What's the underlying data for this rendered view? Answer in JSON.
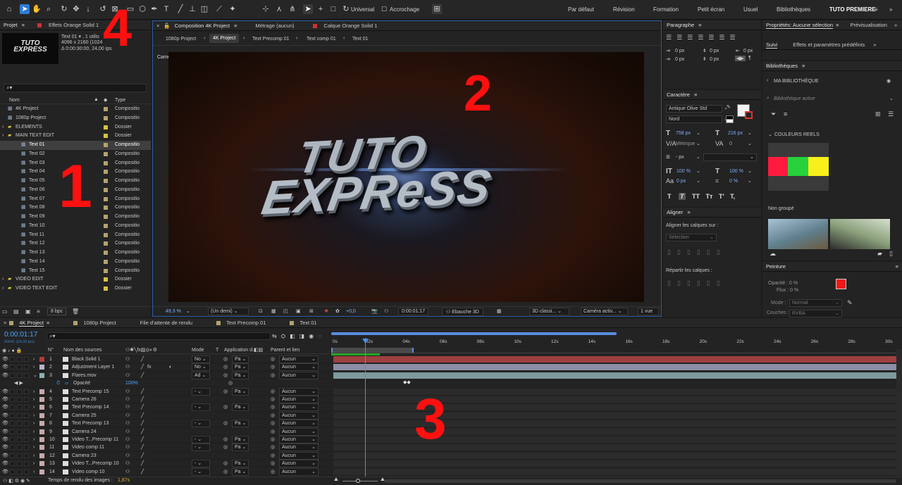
{
  "toolbar": {
    "universal": "Universal",
    "accrochage": "Accrochage"
  },
  "workspaces": [
    "Par défaut",
    "Révision",
    "Formation",
    "Petit écran",
    "Usuel",
    "Bibliothèques",
    "TUTO PREMIERE"
  ],
  "project": {
    "tab": "Projet",
    "effects_tab": "Effets  Orange Solid 1",
    "thumb_text1": "TUTO",
    "thumb_text2": "EXPRESS",
    "info_line1": "Text 01 ▾ , 1 utilis",
    "info_line2": "4096 x 2160  (1024",
    "info_line3": "Δ 0:00:30:00, 24,00 ips",
    "col_name": "Nom",
    "col_type": "Type",
    "bpc": "8 bpc",
    "items": [
      {
        "name": "4K Project",
        "type": "Compositio",
        "color": "#b3a36c",
        "folder": false,
        "indent": 0
      },
      {
        "name": "1080p Project",
        "type": "Compositio",
        "color": "#b3a36c",
        "folder": false,
        "indent": 0
      },
      {
        "name": "ELEMENTS",
        "type": "Dossier",
        "color": "#d6c43f",
        "folder": true,
        "indent": 0
      },
      {
        "name": "MAIN TEXT EDIT",
        "type": "Dossier",
        "color": "#d6c43f",
        "folder": true,
        "indent": 0
      },
      {
        "name": "Text 01",
        "type": "Compositio",
        "color": "#b3a36c",
        "folder": false,
        "indent": 1,
        "selected": true
      },
      {
        "name": "Text 02",
        "type": "Compositio",
        "color": "#b3a36c",
        "folder": false,
        "indent": 1
      },
      {
        "name": "Text 03",
        "type": "Compositio",
        "color": "#b3a36c",
        "folder": false,
        "indent": 1
      },
      {
        "name": "Text 04",
        "type": "Compositio",
        "color": "#b3a36c",
        "folder": false,
        "indent": 1
      },
      {
        "name": "Text 05",
        "type": "Compositio",
        "color": "#b3a36c",
        "folder": false,
        "indent": 1
      },
      {
        "name": "Text 06",
        "type": "Compositio",
        "color": "#b3a36c",
        "folder": false,
        "indent": 1
      },
      {
        "name": "Text 07",
        "type": "Compositio",
        "color": "#b3a36c",
        "folder": false,
        "indent": 1
      },
      {
        "name": "Text 08",
        "type": "Compositio",
        "color": "#b3a36c",
        "folder": false,
        "indent": 1
      },
      {
        "name": "Text 09",
        "type": "Compositio",
        "color": "#b3a36c",
        "folder": false,
        "indent": 1
      },
      {
        "name": "Text 10",
        "type": "Compositio",
        "color": "#b3a36c",
        "folder": false,
        "indent": 1
      },
      {
        "name": "Text 11",
        "type": "Compositio",
        "color": "#b3a36c",
        "folder": false,
        "indent": 1
      },
      {
        "name": "Text 12",
        "type": "Compositio",
        "color": "#b3a36c",
        "folder": false,
        "indent": 1
      },
      {
        "name": "Text 13",
        "type": "Compositio",
        "color": "#b3a36c",
        "folder": false,
        "indent": 1
      },
      {
        "name": "Text 14",
        "type": "Compositio",
        "color": "#b3a36c",
        "folder": false,
        "indent": 1
      },
      {
        "name": "Text 15",
        "type": "Compositio",
        "color": "#b3a36c",
        "folder": false,
        "indent": 1
      },
      {
        "name": "VIDEO EDIT",
        "type": "Dossier",
        "color": "#d6c43f",
        "folder": true,
        "indent": 0
      },
      {
        "name": "VIDEO TEXT EDIT",
        "type": "Dossier",
        "color": "#d6c43f",
        "folder": true,
        "indent": 0
      }
    ]
  },
  "comp": {
    "tab": "Composition  4K Project",
    "metrage_tab": "Métrage  (aucun)",
    "calque_tab": "Calque  Orange Solid 1",
    "breadcrumbs": [
      "1080p Project",
      "4K Project",
      "Text Precomp 01",
      "Text comp 01",
      "Text 01"
    ],
    "active_camera": "Caméra active (Camera 1)",
    "title1": "TUTO",
    "title2": "EXPReSS",
    "zoom": "49,3 %",
    "resolution": "(Un demi)",
    "exposure": "+0,0",
    "timecode": "0:00:01:17",
    "draft": "Ebauche 3D",
    "renderer": "3D classi...",
    "camera": "Caméra activ...",
    "views": "1 vue"
  },
  "paragraph": {
    "title": "Paragraphe",
    "values": [
      "0 px",
      "0 px",
      "0 px",
      "0 px",
      "0 px"
    ]
  },
  "character": {
    "title": "Caractère",
    "font": "Antique Olive Std",
    "style": "Nord",
    "size": "758 px",
    "leading": "216 px",
    "kerning": "Métrique",
    "tracking": "0",
    "stroke": "- px",
    "vscale": "100 %",
    "hscale": "100 %",
    "baseline": "0 px",
    "tsume": "0 %",
    "styles": [
      "T",
      "T",
      "TT",
      "Tт",
      "T'",
      "T,"
    ]
  },
  "align": {
    "title": "Aligner",
    "align_to_label": "Aligner les calques sur :",
    "align_to_value": "Sélection",
    "distribute_label": "Répartir les calques :"
  },
  "properties": {
    "title": "Propriétés: Aucune sélection",
    "preview": "Prévisualisation",
    "suivi": "Suivi",
    "effects": "Effets et paramètres prédéfinis"
  },
  "libraries": {
    "title": "Bibliothèques",
    "my_library": "MA BIBLIOTHÈQUE",
    "active": "Bibliothèque active",
    "colors_title": "COULEURS REELS",
    "ungrouped": "Non groupé",
    "colors": [
      "#ff1a40",
      "#27d13d",
      "#f7f01a"
    ]
  },
  "paint": {
    "title": "Peinture",
    "opacity": "Opacité : 0 %",
    "flow": "Flux : 0 %",
    "mode_label": "Mode :",
    "mode_value": "Normal",
    "channels_label": "Couches :",
    "channels_value": "RVBA"
  },
  "timeline": {
    "tabs": [
      "4K Project",
      "1080p Project",
      "File d'attente de rendu",
      "Text Precomp 01",
      "Text 01"
    ],
    "timecode": "0:00:01:17",
    "fps": "00041 (24,00 ips)",
    "col_source": "Nom des sources",
    "col_mode": "Mode",
    "col_t": "T",
    "col_app": "Application d...",
    "col_parent": "Parent et lien",
    "ruler": [
      "0s",
      "02s",
      "04s",
      "06s",
      "08s",
      "10s",
      "12s",
      "14s",
      "16s",
      "18s",
      "20s",
      "22s",
      "24s",
      "26s",
      "28s",
      "30s"
    ],
    "opacity_label": "Opacité",
    "opacity_value": "100%",
    "render_time_label": "Temps de rendu des images :",
    "render_time_value": "1,87s",
    "layers": [
      {
        "num": "1",
        "name": "Black Solid 1",
        "color": "#b23b3b",
        "mode": "No",
        "mode_dd": true,
        "parent": "Aucun",
        "bar": "#9e4040",
        "fx": false
      },
      {
        "num": "2",
        "name": "Adjustment Layer 1",
        "color": "#b6b6c8",
        "mode": "No",
        "mode_dd": true,
        "parent": "Aucun",
        "bar": "#8d8da6",
        "fx": true
      },
      {
        "num": "3",
        "name": "Flares.mov",
        "color": "#8fb1b4",
        "mode": "Ad",
        "mode_dd": true,
        "parent": "Aucun",
        "bar": "#7e9a9c",
        "fx": false
      },
      {
        "num": "",
        "name": "Opacité",
        "color": "",
        "mode": "",
        "mode_dd": false,
        "parent": "",
        "bar": "",
        "fx": false,
        "sub": true
      },
      {
        "num": "4",
        "name": "Text Precomp 15",
        "color": "#c9a9a9",
        "mode": "-",
        "mode_dd": true,
        "parent": "Aucun",
        "bar": "",
        "fx": false
      },
      {
        "num": "5",
        "name": "Camera 26",
        "color": "#c9a9a9",
        "mode": "",
        "mode_dd": false,
        "parent": "Aucun",
        "bar": "",
        "fx": false
      },
      {
        "num": "6",
        "name": "Text Precomp 14",
        "color": "#c9a9a9",
        "mode": "-",
        "mode_dd": true,
        "parent": "Aucun",
        "bar": "",
        "fx": false
      },
      {
        "num": "7",
        "name": "Camera 25",
        "color": "#c9a9a9",
        "mode": "",
        "mode_dd": false,
        "parent": "Aucun",
        "bar": "",
        "fx": false
      },
      {
        "num": "8",
        "name": "Text Precomp 13",
        "color": "#c9a9a9",
        "mode": "-",
        "mode_dd": true,
        "parent": "Aucun",
        "bar": "",
        "fx": false
      },
      {
        "num": "9",
        "name": "Camera 24",
        "color": "#c9a9a9",
        "mode": "",
        "mode_dd": false,
        "parent": "Aucun",
        "bar": "",
        "fx": false
      },
      {
        "num": "10",
        "name": "Video T...Precomp 11",
        "color": "#c9a9a9",
        "mode": "-",
        "mode_dd": true,
        "parent": "Aucun",
        "bar": "",
        "fx": false
      },
      {
        "num": "11",
        "name": "Video comp 11",
        "color": "#c9a9a9",
        "mode": "-",
        "mode_dd": true,
        "parent": "Aucun",
        "bar": "",
        "fx": false
      },
      {
        "num": "12",
        "name": "Camera 23",
        "color": "#c9a9a9",
        "mode": "",
        "mode_dd": false,
        "parent": "Aucun",
        "bar": "",
        "fx": false
      },
      {
        "num": "13",
        "name": "Video T...Precomp 10",
        "color": "#c9a9a9",
        "mode": "-",
        "mode_dd": true,
        "parent": "Aucun",
        "bar": "",
        "fx": false
      },
      {
        "num": "14",
        "name": "Video comp 10",
        "color": "#c9a9a9",
        "mode": "-",
        "mode_dd": true,
        "parent": "Aucun",
        "bar": "",
        "fx": false
      }
    ]
  },
  "app_dd": "Pa",
  "markers": [
    "1",
    "2",
    "3",
    "4"
  ]
}
